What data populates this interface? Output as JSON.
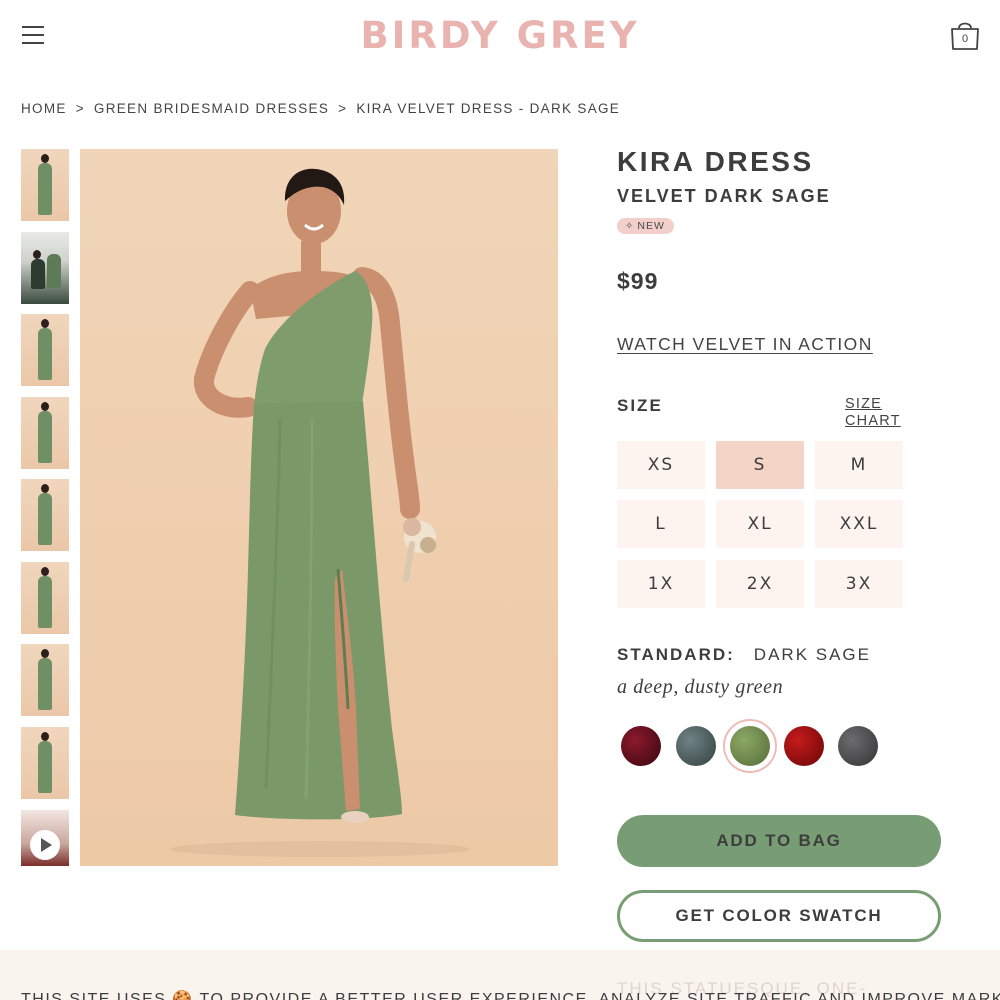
{
  "header": {
    "brand": "BIRDY GREY",
    "cart_count": "0"
  },
  "breadcrumb": {
    "items": [
      "HOME",
      "GREEN BRIDESMAID DRESSES",
      "KIRA VELVET DRESS - DARK SAGE"
    ],
    "separator": ">"
  },
  "product": {
    "title": "KIRA DRESS",
    "subtitle": "VELVET DARK SAGE",
    "badge": "NEW",
    "price": "$99",
    "watch_link": "WATCH VELVET IN ACTION"
  },
  "size": {
    "label": "SIZE",
    "chart_link": "SIZE CHART",
    "options": [
      "XS",
      "S",
      "M",
      "L",
      "XL",
      "XXL",
      "1X",
      "2X",
      "3X"
    ],
    "selected": "S"
  },
  "color": {
    "standard_label": "STANDARD:",
    "name": "DARK SAGE",
    "description": "a deep, dusty green",
    "swatches": [
      {
        "name": "burgundy-velvet",
        "color": "#5a0f1a"
      },
      {
        "name": "slate-velvet",
        "color": "#4d5c5e"
      },
      {
        "name": "dark-sage-velvet",
        "color": "#6e8a4e"
      },
      {
        "name": "red-velvet",
        "color": "#8c0e10"
      },
      {
        "name": "charcoal-velvet",
        "color": "#4a4a4c"
      }
    ],
    "selected_index": 2
  },
  "actions": {
    "add_to_bag": "ADD TO BAG",
    "get_swatch": "GET COLOR SWATCH"
  },
  "cookie": {
    "text": "THIS SITE USES 🍪 TO PROVIDE A BETTER USER EXPERIENCE, ANALYZE SITE TRAFFIC AND IMPROVE MARKETING",
    "faded_text": "THIS STATUESQUE, ONE-"
  },
  "colors": {
    "brand_pink": "#e9b3b0",
    "sage": "#789d74",
    "size_bg": "#fdf4ef",
    "size_selected_bg": "#f3d4c6"
  }
}
